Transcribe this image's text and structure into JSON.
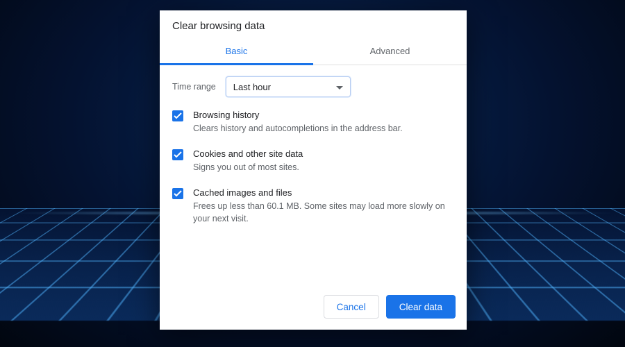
{
  "dialog": {
    "title": "Clear browsing data",
    "tabs": {
      "basic": "Basic",
      "advanced": "Advanced"
    },
    "time_range": {
      "label": "Time range",
      "value": "Last hour"
    },
    "options": [
      {
        "title": "Browsing history",
        "desc": "Clears history and autocompletions in the address bar."
      },
      {
        "title": "Cookies and other site data",
        "desc": "Signs you out of most sites."
      },
      {
        "title": "Cached images and files",
        "desc": "Frees up less than 60.1 MB. Some sites may load more slowly on your next visit."
      }
    ],
    "buttons": {
      "cancel": "Cancel",
      "clear": "Clear data"
    }
  }
}
